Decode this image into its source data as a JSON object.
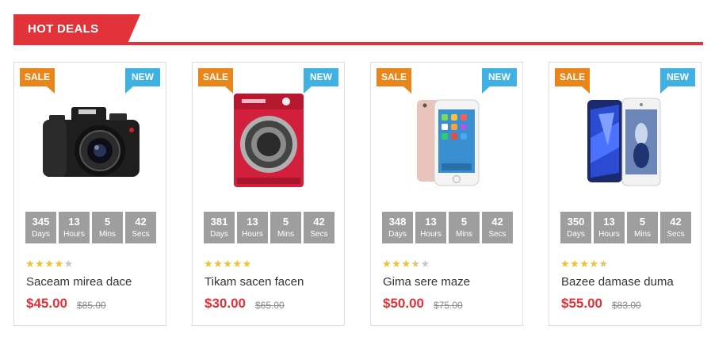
{
  "section": {
    "title": "HOT DEALS"
  },
  "colors": {
    "accent": "#e3333a",
    "sale_badge": "#e98519",
    "new_badge": "#3fb2e3",
    "countdown_bg": "#9e9e9e",
    "star": "#f2c12e"
  },
  "labels": {
    "days": "Days",
    "hours": "Hours",
    "mins": "Mins",
    "secs": "Secs"
  },
  "products": [
    {
      "sale": "SALE",
      "new": "NEW",
      "image_icon": "dslr-camera",
      "countdown": {
        "days": "345",
        "hours": "13",
        "mins": "5",
        "secs": "42"
      },
      "rating": 4,
      "name": "Saceam mirea dace",
      "price": "$45.00",
      "old_price": "$85.00"
    },
    {
      "sale": "SALE",
      "new": "NEW",
      "image_icon": "washing-machine",
      "countdown": {
        "days": "381",
        "hours": "13",
        "mins": "5",
        "secs": "42"
      },
      "rating": 5,
      "name": "Tikam sacen facen",
      "price": "$30.00",
      "old_price": "$65.00"
    },
    {
      "sale": "SALE",
      "new": "NEW",
      "image_icon": "smartphone-iphone",
      "countdown": {
        "days": "348",
        "hours": "13",
        "mins": "5",
        "secs": "42"
      },
      "rating": 3.5,
      "name": "Gima sere maze",
      "price": "$50.00",
      "old_price": "$75.00"
    },
    {
      "sale": "SALE",
      "new": "NEW",
      "image_icon": "smartphones-pair",
      "countdown": {
        "days": "350",
        "hours": "13",
        "mins": "5",
        "secs": "42"
      },
      "rating": 4.5,
      "name": "Bazee damase duma",
      "price": "$55.00",
      "old_price": "$83.00"
    }
  ]
}
